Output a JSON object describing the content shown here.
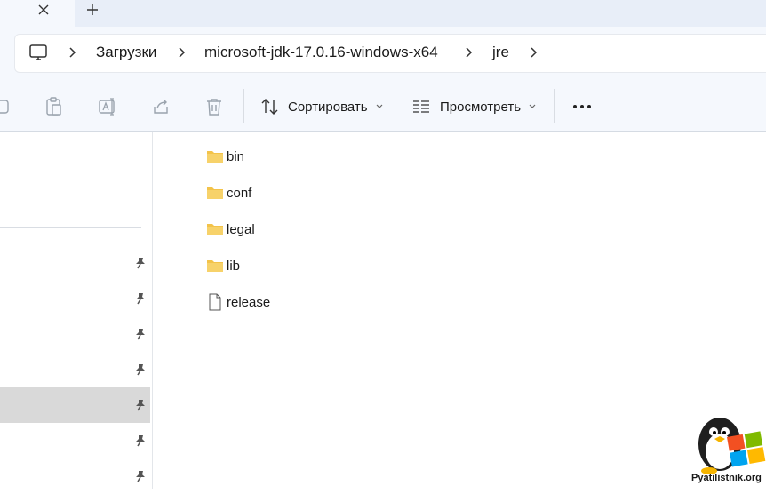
{
  "tabs": {
    "close_icon": "close-icon",
    "new_tab_icon": "plus-icon"
  },
  "breadcrumb": {
    "root_icon": "this-pc-icon",
    "items": [
      "Загрузки",
      "microsoft-jdk-17.0.16-windows-x64",
      "jre"
    ]
  },
  "toolbar": {
    "icons": [
      "copy-icon",
      "paste-icon",
      "rename-icon",
      "share-icon",
      "delete-icon"
    ],
    "sort_label": "Сортировать",
    "view_label": "Просмотреть",
    "more_icon": "more-icon"
  },
  "files": [
    {
      "name": "bin",
      "type": "folder"
    },
    {
      "name": "conf",
      "type": "folder"
    },
    {
      "name": "legal",
      "type": "folder"
    },
    {
      "name": "lib",
      "type": "folder"
    },
    {
      "name": "release",
      "type": "file"
    }
  ],
  "sidebar": {
    "pinned_count": 7,
    "selected_index": 4
  },
  "watermark": {
    "text": "Pyatilistnik.org"
  },
  "colors": {
    "folder": "#f3c34a",
    "chrome_bg": "#f5f8fd",
    "selection": "#d9d9d9"
  }
}
